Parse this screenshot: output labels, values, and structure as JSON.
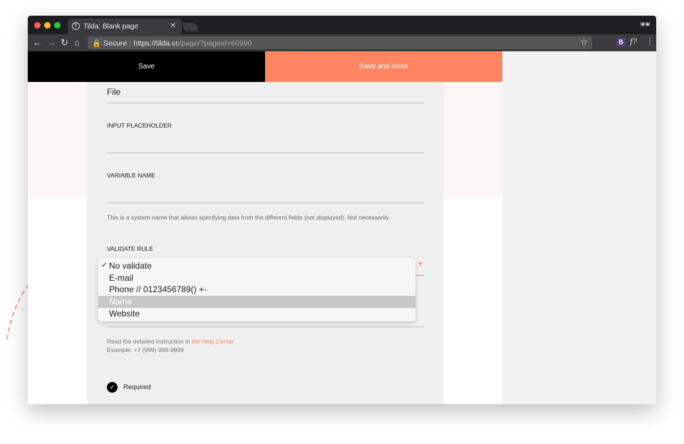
{
  "browser": {
    "tab_title": "Tilda: Blank page",
    "secure_label": "Secure",
    "url_host": "https://tilda.cc",
    "url_path": "/page/?pageid=60990",
    "ext_b": "B",
    "ext_f": "f?"
  },
  "toolbar": {
    "save_label": "Save",
    "save_close_label": "Save and close",
    "accent": "#ff8562"
  },
  "form": {
    "file_value": "File",
    "placeholder_label": "Input placeholder",
    "variable_label": "Variable name",
    "variable_help": "This is a system name that allows specifying data from the different fields (not displayed). Not necessarily.",
    "validate_label": "Validate rule",
    "options": [
      "No validate",
      "E-mail",
      "Phone // 0123456789() +-",
      "Name",
      "Website"
    ],
    "checked_option": "No validate",
    "highlighted_option": "Name",
    "help_prefix": "Read the detailed instruction in ",
    "help_link": "the Help Center",
    "example": "Example: +7 (999) 999-9999",
    "required_label": "Required"
  }
}
